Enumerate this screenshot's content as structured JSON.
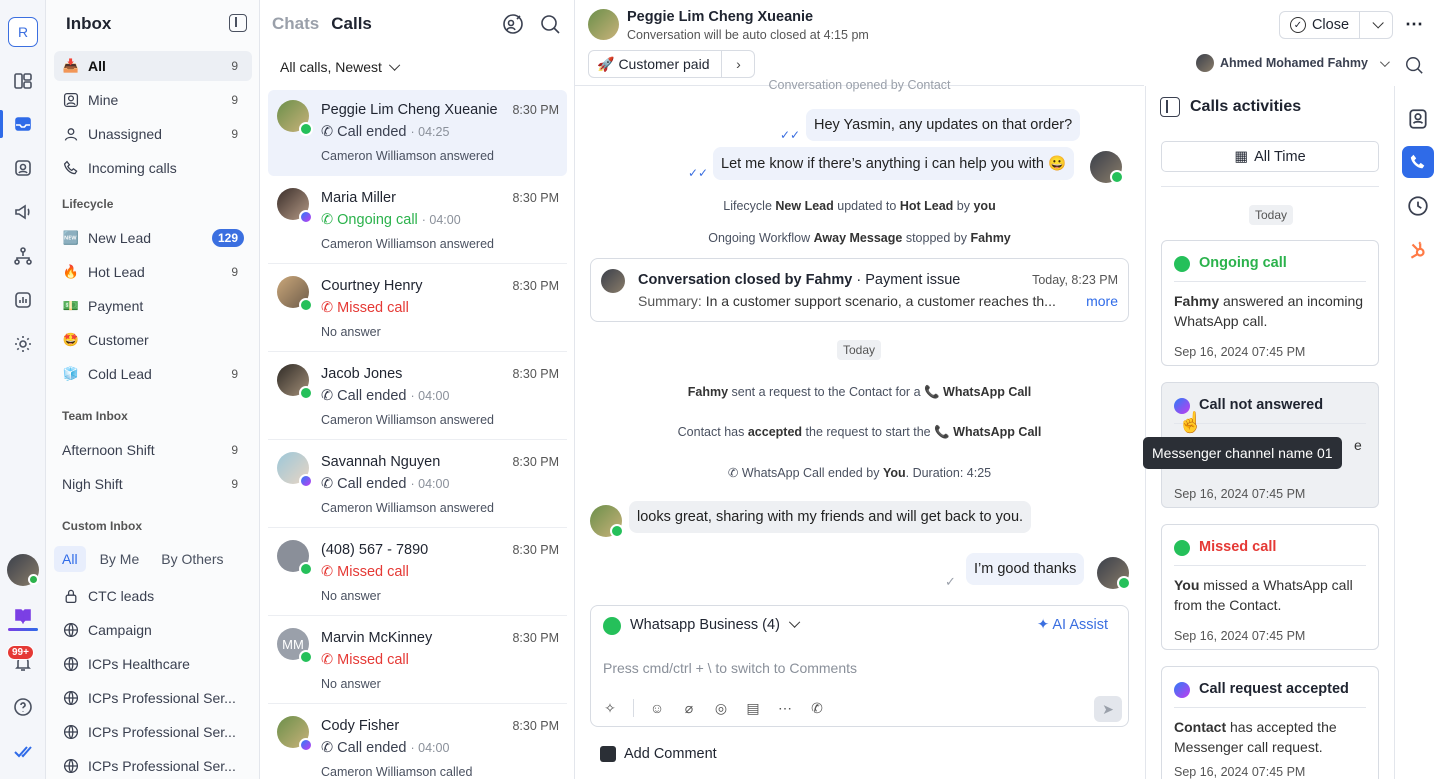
{
  "rail": {
    "workspace": "R",
    "notifications": "99+"
  },
  "inbox": {
    "title": "Inbox",
    "items": [
      {
        "label": "All",
        "count": "9",
        "icon": "inbox-icon"
      },
      {
        "label": "Mine",
        "count": "9",
        "icon": "user-square-icon"
      },
      {
        "label": "Unassigned",
        "count": "9",
        "icon": "user-icon"
      },
      {
        "label": "Incoming calls",
        "count": "",
        "icon": "phone-icon"
      }
    ],
    "lifecycle_title": "Lifecycle",
    "lifecycle": [
      {
        "label": "New Lead",
        "count": "129",
        "emoji": "🆕"
      },
      {
        "label": "Hot Lead",
        "count": "9",
        "emoji": "🔥"
      },
      {
        "label": "Payment",
        "count": "",
        "emoji": "💵"
      },
      {
        "label": "Customer",
        "count": "",
        "emoji": "🤩"
      },
      {
        "label": "Cold Lead",
        "count": "9",
        "emoji": "🧊"
      }
    ],
    "team_title": "Team Inbox",
    "team": [
      {
        "label": "Afternoon Shift",
        "count": "9"
      },
      {
        "label": "Nigh Shift",
        "count": "9"
      }
    ],
    "custom_title": "Custom Inbox",
    "custom_tabs": [
      "All",
      "By Me",
      "By Others"
    ],
    "custom": [
      "CTC leads",
      "Campaign",
      "ICPs Healthcare",
      "ICPs Professional Ser...",
      "ICPs Professional Ser...",
      "ICPs Professional Ser..."
    ]
  },
  "calls": {
    "tab_chats": "Chats",
    "tab_calls": "Calls",
    "filter": "All calls, Newest",
    "rows": [
      {
        "name": "Peggie Lim Cheng Xueanie",
        "time": "8:30 PM",
        "status": "Call ended",
        "dur": "· 04:25",
        "sub": "Cameron Williamson answered",
        "kind": "ended",
        "ch": "wa"
      },
      {
        "name": "Maria Miller",
        "time": "8:30 PM",
        "status": "Ongoing call",
        "dur": "· 04:00",
        "sub": "Cameron Williamson answered",
        "kind": "ongoing",
        "ch": "ms"
      },
      {
        "name": "Courtney Henry",
        "time": "8:30 PM",
        "status": "Missed call",
        "dur": "",
        "sub": "No answer",
        "kind": "missed",
        "ch": "wa"
      },
      {
        "name": "Jacob Jones",
        "time": "8:30 PM",
        "status": "Call ended",
        "dur": "· 04:00",
        "sub": "Cameron Williamson answered",
        "kind": "ended",
        "ch": "wa"
      },
      {
        "name": "Savannah Nguyen",
        "time": "8:30 PM",
        "status": "Call ended",
        "dur": "· 04:00",
        "sub": "Cameron Williamson answered",
        "kind": "ended",
        "ch": "ms"
      },
      {
        "name": "(408) 567 - 7890",
        "time": "8:30 PM",
        "status": "Missed call",
        "dur": "",
        "sub": "No answer",
        "kind": "missed",
        "ch": "wa"
      },
      {
        "name": "Marvin McKinney",
        "time": "8:30 PM",
        "status": "Missed call",
        "dur": "",
        "sub": "No answer",
        "kind": "missed",
        "ch": "wa",
        "initials": "MM"
      },
      {
        "name": "Cody Fisher",
        "time": "8:30 PM",
        "status": "Call ended",
        "dur": "· 04:00",
        "sub": "Cameron Williamson called",
        "kind": "ended",
        "ch": "ms"
      }
    ]
  },
  "chat": {
    "name": "Peggie Lim Cheng Xueanie",
    "sub": "Conversation will be auto closed at 4:15 pm",
    "chip": "Customer paid",
    "close": "Close",
    "assignee": "Ahmed Mohamed Fahmy",
    "opened": "Conversation opened by Contact",
    "msg1": "Hey Yasmin, any updates on that order?",
    "msg2": "Let me know if there’s anything i can help you with 😀",
    "lifecycle_sys": {
      "a": "Lifecycle",
      "b": "New Lead",
      "c": "updated to",
      "d": "Hot Lead",
      "e": "by",
      "f": "you"
    },
    "workflow_sys": {
      "a": "Ongoing Workflow",
      "b": "Away Message",
      "c": "stopped by",
      "d": "Fahmy"
    },
    "closed_title": "Conversation closed by Fahmy",
    "closed_reason": "· Payment issue",
    "closed_time": "Today, 8:23 PM",
    "closed_summary_label": "Summary:",
    "closed_summary": "In a customer support scenario, a customer reaches th...",
    "more": "more",
    "today": "Today",
    "req_sys": {
      "a": "Fahmy",
      "b": "sent a request to the Contact for a",
      "c": "WhatsApp Call"
    },
    "acc_sys": {
      "a": "Contact has",
      "b": "accepted",
      "c": "the request to start the",
      "d": "WhatsApp Call"
    },
    "end_sys": {
      "a": "WhatsApp Call ended by",
      "b": "You",
      "c": ". Duration: 4:25"
    },
    "msg3": "looks great, sharing with my friends and will get back to you.",
    "msg4": "I’m good thanks",
    "channel": "Whatsapp Business (4)",
    "ai": "AI Assist",
    "placeholder": "Press cmd/ctrl + \\ to switch to Comments",
    "add_comment": "Add Comment"
  },
  "activities": {
    "title": "Calls activities",
    "range": "All Time",
    "today": "Today",
    "cards": [
      {
        "title": "Ongoing call",
        "color": "#2bb24c",
        "body_b": "Fahmy",
        "body": " answered an incoming WhatsApp call.",
        "date": "Sep 16, 2024 07:45 PM",
        "ch": "wa"
      },
      {
        "title": "Call not answered",
        "color": "#1f2430",
        "body_b": "",
        "body": "",
        "date": "Sep 16, 2024 07:45 PM",
        "ch": "ms",
        "peek": "e"
      },
      {
        "title": "Missed call",
        "color": "#e53935",
        "body_b": "You",
        "body": " missed a WhatsApp call from the Contact.",
        "date": "Sep 16, 2024 07:45 PM",
        "ch": "wa"
      },
      {
        "title": "Call request accepted",
        "color": "#1f2430",
        "body_b": "Contact",
        "body": " has accepted the Messenger call request.",
        "date": "Sep 16, 2024 07:45 PM",
        "ch": "ms"
      }
    ],
    "tooltip": "Messenger channel name 01"
  }
}
